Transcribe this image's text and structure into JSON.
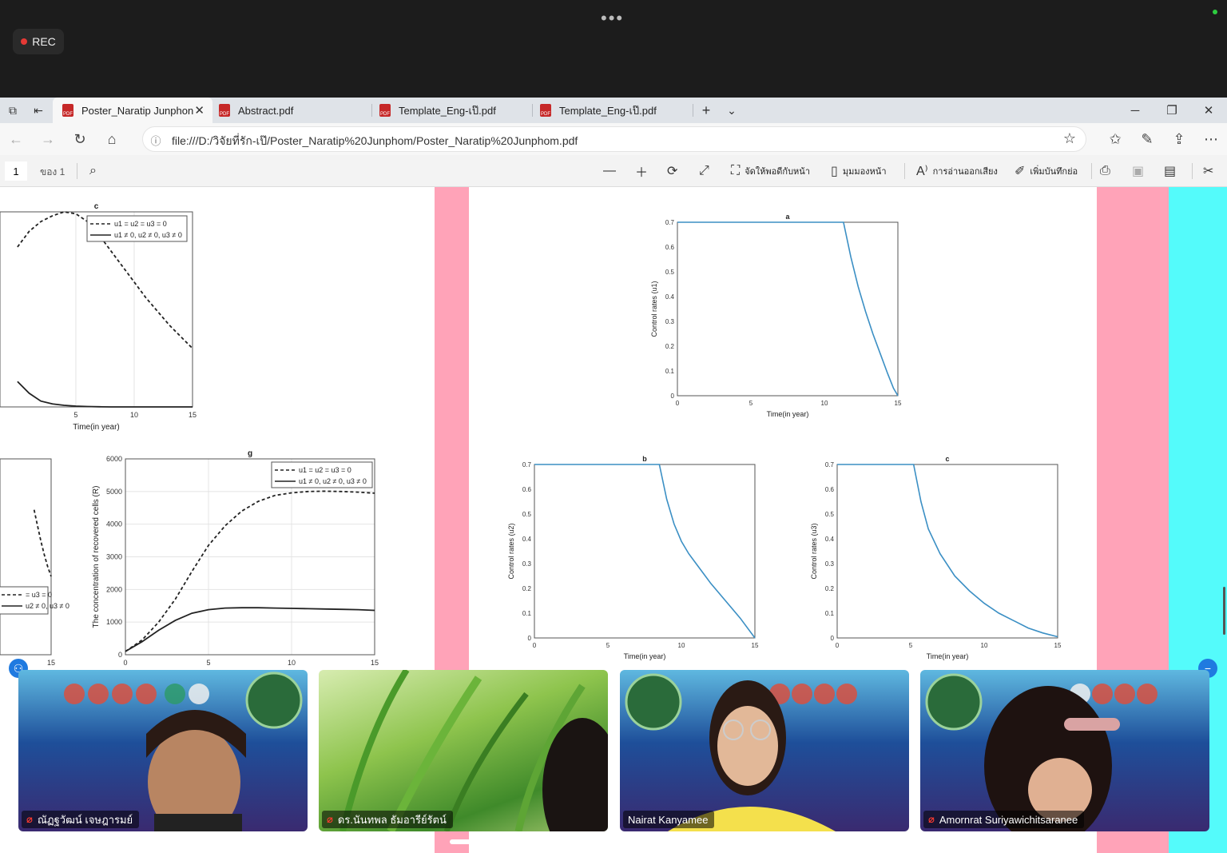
{
  "meeting": {
    "rec_label": "REC",
    "more": "•••"
  },
  "tabs": [
    {
      "label": "Poster_Naratip Junphon",
      "active": true
    },
    {
      "label": "Abstract.pdf"
    },
    {
      "label": "Template_Eng-เป๊.pdf"
    },
    {
      "label": "Template_Eng-เป๊.pdf"
    }
  ],
  "address": {
    "url": "file:///D:/วิจัยที่รัก-เป๊/Poster_Naratip%20Junphom/Poster_Naratip%20Junphom.pdf"
  },
  "pdf_toolbar": {
    "page": "1",
    "of": "ของ 1",
    "fit": "จัดให้พอดีกับหน้า",
    "view": "มุมมองหน้า",
    "read_aloud": "การอ่านออกเสียง",
    "add_note": "เพิ่มบันทึกย่อ"
  },
  "chart_data": [
    {
      "type": "line",
      "title": "c",
      "xlabel": "Time(in year)",
      "xticks": [
        "5",
        "10",
        "15"
      ],
      "legend": [
        "u1 = u2 = u3 = 0",
        "u1 ≠ 0, u2 ≠ 0, u3 ≠ 0"
      ],
      "x": [
        0,
        1,
        2,
        3,
        4,
        5,
        6,
        7,
        8,
        9,
        10,
        11,
        12,
        13,
        14,
        15
      ],
      "xlim": [
        -1.5,
        15
      ],
      "ylim": [
        0,
        1
      ],
      "series": [
        {
          "values": [
            0.82,
            0.9,
            0.95,
            0.98,
            1.0,
            0.99,
            0.95,
            0.88,
            0.8,
            0.72,
            0.64,
            0.56,
            0.49,
            0.42,
            0.36,
            0.3
          ]
        },
        {
          "values": [
            0.13,
            0.07,
            0.03,
            0.015,
            0.008,
            0.004,
            0.002,
            0.001,
            0,
            0,
            0,
            0,
            0,
            0,
            0,
            0
          ]
        }
      ]
    },
    {
      "type": "line",
      "xticks": [
        "15"
      ],
      "legend": [
        "= u3 = 0",
        "u2 ≠ 0, u3 ≠ 0"
      ],
      "x": [
        10,
        11,
        12,
        13,
        14,
        15
      ],
      "xlim": [
        0,
        15
      ],
      "ylim": [
        0,
        1
      ],
      "series": [
        {
          "values": [
            0.74,
            0.66,
            0.58,
            0.51,
            0.45,
            0.4
          ]
        }
      ]
    },
    {
      "type": "line",
      "title": "g",
      "xlabel": "",
      "ylabel": "The concentration of recovered cells (R)",
      "xticks": [
        "0",
        "5",
        "10",
        "15"
      ],
      "yticks": [
        "0",
        "1000",
        "2000",
        "3000",
        "4000",
        "5000",
        "6000"
      ],
      "legend": [
        "u1 = u2 = u3 = 0",
        "u1 ≠ 0, u2 ≠ 0, u3 ≠ 0"
      ],
      "x": [
        0,
        1,
        2,
        3,
        4,
        5,
        6,
        7,
        8,
        9,
        10,
        11,
        12,
        13,
        14,
        15
      ],
      "xlim": [
        0,
        15
      ],
      "ylim": [
        0,
        6000
      ],
      "series": [
        {
          "values": [
            100,
            450,
            1000,
            1700,
            2550,
            3350,
            3950,
            4400,
            4700,
            4880,
            4960,
            5000,
            5010,
            5000,
            4980,
            4950
          ]
        },
        {
          "values": [
            100,
            400,
            750,
            1050,
            1270,
            1380,
            1430,
            1440,
            1440,
            1430,
            1420,
            1410,
            1400,
            1390,
            1380,
            1360
          ]
        }
      ]
    },
    {
      "type": "line",
      "title": "a",
      "xlabel": "Time(in year)",
      "ylabel": "Control rates (u1)",
      "xticks": [
        "0",
        "5",
        "10",
        "15"
      ],
      "yticks": [
        "0",
        "0.1",
        "0.2",
        "0.3",
        "0.4",
        "0.5",
        "0.6",
        "0.7"
      ],
      "x": [
        0,
        11.3,
        11.8,
        12.3,
        12.8,
        13.3,
        13.8,
        14.3,
        14.7,
        15
      ],
      "xlim": [
        0,
        15
      ],
      "ylim": [
        0,
        0.7
      ],
      "color": "#3b8fc4",
      "series": [
        {
          "values": [
            0.7,
            0.7,
            0.56,
            0.44,
            0.34,
            0.25,
            0.17,
            0.09,
            0.03,
            0
          ]
        }
      ]
    },
    {
      "type": "line",
      "title": "b",
      "xlabel": "Time(in year)",
      "ylabel": "Control rates (u2)",
      "xticks": [
        "0",
        "5",
        "10",
        "15"
      ],
      "yticks": [
        "0",
        "0.1",
        "0.2",
        "0.3",
        "0.4",
        "0.5",
        "0.6",
        "0.7"
      ],
      "x": [
        0,
        8.5,
        9.0,
        9.5,
        10,
        10.5,
        11,
        11.5,
        12,
        13,
        14,
        15
      ],
      "xlim": [
        0,
        15
      ],
      "ylim": [
        0,
        0.7
      ],
      "color": "#3b8fc4",
      "series": [
        {
          "values": [
            0.7,
            0.7,
            0.56,
            0.46,
            0.39,
            0.34,
            0.3,
            0.26,
            0.22,
            0.15,
            0.08,
            0
          ]
        }
      ]
    },
    {
      "type": "line",
      "title": "c",
      "xlabel": "Time(in year)",
      "ylabel": "Control rates (u3)",
      "xticks": [
        "0",
        "5",
        "10",
        "15"
      ],
      "yticks": [
        "0",
        "0.1",
        "0.2",
        "0.3",
        "0.4",
        "0.5",
        "0.6",
        "0.7"
      ],
      "x": [
        0,
        5.2,
        5.7,
        6.2,
        7,
        8,
        9,
        10,
        11,
        12,
        13,
        14,
        15
      ],
      "xlim": [
        0,
        15
      ],
      "ylim": [
        0,
        0.7
      ],
      "color": "#3b8fc4",
      "series": [
        {
          "values": [
            0.7,
            0.7,
            0.55,
            0.44,
            0.34,
            0.25,
            0.19,
            0.14,
            0.1,
            0.07,
            0.04,
            0.02,
            0.005
          ]
        }
      ]
    }
  ],
  "participants": [
    {
      "name": "ณัฏฐวัฒน์ เจษฎารมย์",
      "muted": true
    },
    {
      "name": "ดร.นันทพล ธัมอารีย์รัตน์",
      "muted": true
    },
    {
      "name": "Nairat Kanyamee",
      "muted": false
    },
    {
      "name": "Amornrat Suriyawichitsaranee",
      "muted": true
    }
  ],
  "colors": {
    "pink_margin": "#ffa3b8",
    "cyan_margin": "#54fbfb",
    "plot_line": "#3b8fc4"
  }
}
